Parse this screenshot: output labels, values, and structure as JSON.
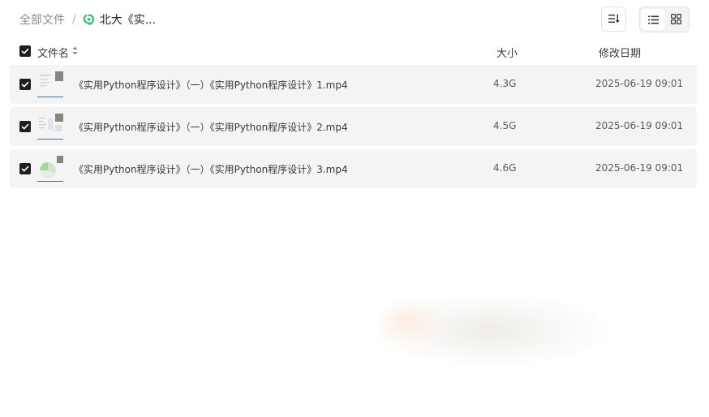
{
  "breadcrumb": {
    "root": "全部文件",
    "separator": "/",
    "current": "北大《实...",
    "current_icon": "folder-share-icon"
  },
  "toolbar": {
    "sort_icon": "sort-icon",
    "view_list_icon": "list-view-icon",
    "view_grid_icon": "grid-view-icon",
    "active_view": "list"
  },
  "table": {
    "columns": {
      "name": "文件名",
      "size": "大小",
      "modified": "修改日期"
    },
    "rows": [
      {
        "name": "《实用Python程序设计》（一）《实用Python程序设计》1.mp4",
        "size": "4.3G",
        "modified": "2025-06-19 09:01",
        "checked": true
      },
      {
        "name": "《实用Python程序设计》（一）《实用Python程序设计》2.mp4",
        "size": "4.5G",
        "modified": "2025-06-19 09:01",
        "checked": true
      },
      {
        "name": "《实用Python程序设计》（一）《实用Python程序设计》3.mp4",
        "size": "4.6G",
        "modified": "2025-06-19 09:01",
        "checked": true
      }
    ]
  },
  "colors": {
    "row_bg": "#f4f4f4",
    "checkbox": "#1f1f1f",
    "brand_green": "#2fbf71"
  }
}
